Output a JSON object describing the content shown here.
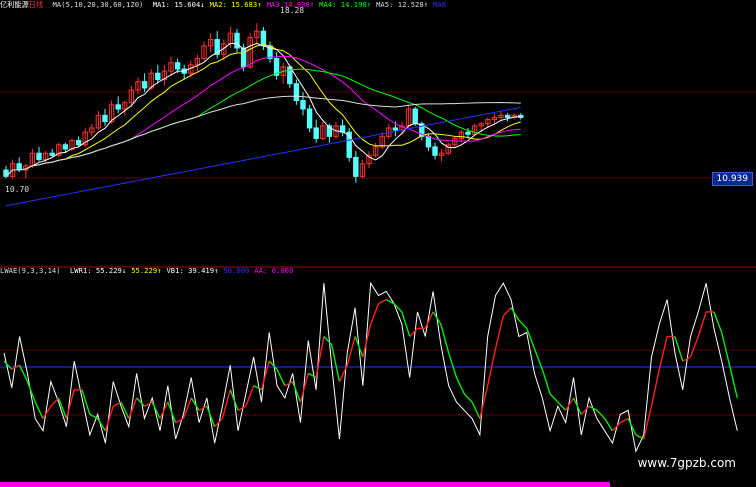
{
  "header_top": {
    "stock": "亿利能源",
    "period": "日线",
    "ma_params": "MA(5,10,20,30,60,120)",
    "items": [
      {
        "label": "MA1:",
        "value": "15.604",
        "arrow": "↓",
        "color": "#ffffff"
      },
      {
        "label": "MA2:",
        "value": "15.683",
        "arrow": "↑",
        "color": "#ffff00"
      },
      {
        "label": "MA3",
        "value": "14.938",
        "arrow": "↑",
        "color": "#ff00ff"
      },
      {
        "label": "MA4:",
        "value": "14.198",
        "arrow": "↑",
        "color": "#00ff00"
      },
      {
        "label": "MA5:",
        "value": "12.528",
        "arrow": "↑",
        "color": "#dcdcdc"
      },
      {
        "label": "MA6",
        "value": "",
        "arrow": "",
        "color": "#2233ff"
      }
    ]
  },
  "header_bottom": {
    "indicator": "LWAE(9,3,3,14)",
    "items": [
      {
        "label": "LWR1:",
        "value": "55.229",
        "arrow": "↓",
        "color": "#ffffff"
      },
      {
        "label": "",
        "value": "55.229",
        "arrow": "↑",
        "color": "#ffff00"
      },
      {
        "label": "VB1:",
        "value": "39.419",
        "arrow": "↑",
        "color": "#ffffff"
      },
      {
        "label": "",
        "value": "90.000",
        "arrow": "",
        "color": "#2233ff"
      },
      {
        "label": "AA:",
        "value": "0.000",
        "arrow": "",
        "color": "#ff00ff"
      }
    ]
  },
  "price_labels": {
    "high": "18.28",
    "low": "10.70",
    "current": "10.939"
  },
  "watermark": "www.7gpzb.com",
  "colors": {
    "up": "#ff3030",
    "down": "#54ffff",
    "bg": "#000000",
    "axis": "#8b0000"
  },
  "chart_data": [
    {
      "type": "candlestick",
      "ylim": [
        7.5,
        19.0
      ],
      "candles": [
        [
          11.3,
          11.5,
          10.9,
          11.0
        ],
        [
          11.0,
          11.8,
          10.9,
          11.6
        ],
        [
          11.6,
          11.9,
          11.2,
          11.3
        ],
        [
          11.3,
          11.6,
          10.9,
          11.5
        ],
        [
          11.5,
          12.3,
          11.4,
          12.1
        ],
        [
          12.1,
          12.4,
          11.7,
          11.8
        ],
        [
          11.8,
          12.2,
          11.6,
          12.1
        ],
        [
          12.1,
          12.3,
          11.9,
          12.0
        ],
        [
          12.0,
          12.6,
          11.9,
          12.5
        ],
        [
          12.5,
          12.6,
          12.1,
          12.3
        ],
        [
          12.3,
          12.8,
          12.2,
          12.7
        ],
        [
          12.7,
          12.9,
          12.4,
          12.5
        ],
        [
          12.5,
          13.3,
          12.4,
          13.1
        ],
        [
          13.1,
          13.5,
          12.9,
          13.3
        ],
        [
          13.3,
          14.1,
          13.2,
          13.9
        ],
        [
          13.9,
          14.2,
          13.4,
          13.6
        ],
        [
          13.6,
          14.6,
          13.5,
          14.4
        ],
        [
          14.4,
          14.8,
          14.0,
          14.2
        ],
        [
          14.2,
          14.6,
          13.9,
          14.5
        ],
        [
          14.5,
          15.3,
          14.3,
          15.1
        ],
        [
          15.1,
          15.7,
          14.9,
          15.5
        ],
        [
          15.5,
          15.9,
          15.0,
          15.2
        ],
        [
          15.2,
          16.1,
          15.1,
          15.9
        ],
        [
          15.9,
          16.3,
          15.4,
          15.6
        ],
        [
          15.6,
          16.3,
          15.3,
          16.0
        ],
        [
          16.0,
          16.7,
          15.8,
          16.4
        ],
        [
          16.4,
          16.6,
          15.9,
          16.1
        ],
        [
          16.1,
          16.3,
          15.6,
          15.9
        ],
        [
          15.9,
          16.5,
          15.7,
          16.3
        ],
        [
          16.3,
          16.8,
          16.0,
          16.6
        ],
        [
          16.6,
          17.4,
          16.5,
          17.2
        ],
        [
          17.2,
          17.8,
          16.9,
          17.5
        ],
        [
          17.5,
          17.9,
          16.6,
          16.8
        ],
        [
          16.8,
          17.5,
          16.5,
          17.3
        ],
        [
          17.3,
          18.1,
          17.1,
          17.8
        ],
        [
          17.8,
          18.0,
          16.9,
          17.1
        ],
        [
          17.1,
          17.3,
          16.0,
          16.2
        ],
        [
          16.2,
          17.8,
          16.1,
          17.6
        ],
        [
          17.6,
          18.28,
          17.3,
          17.9
        ],
        [
          17.9,
          18.1,
          17.0,
          17.2
        ],
        [
          17.2,
          17.4,
          16.4,
          16.6
        ],
        [
          16.6,
          16.9,
          15.6,
          15.8
        ],
        [
          15.8,
          16.4,
          15.4,
          16.2
        ],
        [
          16.2,
          16.3,
          15.2,
          15.4
        ],
        [
          15.4,
          15.6,
          14.4,
          14.6
        ],
        [
          14.6,
          15.0,
          13.9,
          14.2
        ],
        [
          14.2,
          14.4,
          13.1,
          13.3
        ],
        [
          13.3,
          13.7,
          12.6,
          12.8
        ],
        [
          12.8,
          13.6,
          12.7,
          13.4
        ],
        [
          13.4,
          13.5,
          12.6,
          12.9
        ],
        [
          12.9,
          13.6,
          12.8,
          13.4
        ],
        [
          13.4,
          13.7,
          12.9,
          13.1
        ],
        [
          13.1,
          13.3,
          11.7,
          11.9
        ],
        [
          11.9,
          12.2,
          10.7,
          11.0
        ],
        [
          11.0,
          11.8,
          10.9,
          11.6
        ],
        [
          11.6,
          12.2,
          11.4,
          12.0
        ],
        [
          12.0,
          12.6,
          11.9,
          12.4
        ],
        [
          12.4,
          13.1,
          12.3,
          12.9
        ],
        [
          12.9,
          13.5,
          12.8,
          13.3
        ],
        [
          13.3,
          13.6,
          12.9,
          13.2
        ],
        [
          13.2,
          13.6,
          13.0,
          13.4
        ],
        [
          13.4,
          14.4,
          13.3,
          14.2
        ],
        [
          14.2,
          14.3,
          13.4,
          13.5
        ],
        [
          13.5,
          13.6,
          12.7,
          12.9
        ],
        [
          12.9,
          13.0,
          12.2,
          12.4
        ],
        [
          12.4,
          12.6,
          11.8,
          12.0
        ],
        [
          12.0,
          12.3,
          11.7,
          12.1
        ],
        [
          12.1,
          12.6,
          12.0,
          12.5
        ],
        [
          12.5,
          12.9,
          12.4,
          12.8
        ],
        [
          12.8,
          13.2,
          12.6,
          13.1
        ],
        [
          13.1,
          13.3,
          12.8,
          13.0
        ],
        [
          13.0,
          13.5,
          12.9,
          13.4
        ],
        [
          13.4,
          13.6,
          13.1,
          13.5
        ],
        [
          13.5,
          13.8,
          13.3,
          13.7
        ],
        [
          13.7,
          14.0,
          13.5,
          13.8
        ],
        [
          13.8,
          14.1,
          13.6,
          13.9
        ],
        [
          13.9,
          14.0,
          13.6,
          13.8
        ],
        [
          13.8,
          14.0,
          13.7,
          13.9
        ],
        [
          13.9,
          14.0,
          13.7,
          13.8
        ]
      ]
    },
    {
      "type": "line",
      "ylim": [
        0,
        100
      ],
      "series": [
        {
          "name": "LWR1",
          "values": [
            62,
            45,
            70,
            52,
            30,
            24,
            48,
            38,
            26,
            58,
            40,
            22,
            32,
            18,
            48,
            36,
            26,
            52,
            30,
            40,
            24,
            46,
            20,
            32,
            50,
            28,
            40,
            18,
            36,
            56,
            24,
            42,
            60,
            38,
            72,
            46,
            40,
            52,
            28,
            68,
            44,
            96,
            56,
            20,
            62,
            84,
            46,
            96,
            90,
            92,
            86,
            76,
            50,
            82,
            70,
            92,
            66,
            46,
            38,
            34,
            30,
            22,
            70,
            90,
            96,
            88,
            70,
            72,
            52,
            40,
            24,
            36,
            28,
            50,
            22,
            40,
            30,
            24,
            18,
            32,
            34,
            14,
            22,
            60,
            76,
            88,
            62,
            44,
            70,
            82,
            96,
            74,
            58,
            40,
            24
          ]
        },
        {
          "name": "LWR2",
          "values": [
            58,
            54,
            56,
            48,
            38,
            30,
            36,
            40,
            30,
            44,
            44,
            32,
            30,
            24,
            36,
            38,
            30,
            40,
            36,
            38,
            30,
            38,
            28,
            30,
            40,
            34,
            36,
            26,
            30,
            44,
            34,
            36,
            46,
            44,
            58,
            54,
            46,
            48,
            38,
            52,
            50,
            70,
            66,
            48,
            56,
            70,
            60,
            76,
            86,
            88,
            86,
            82,
            70,
            74,
            74,
            82,
            76,
            62,
            50,
            42,
            38,
            30,
            46,
            64,
            80,
            84,
            78,
            74,
            64,
            54,
            42,
            38,
            34,
            40,
            32,
            36,
            34,
            30,
            24,
            28,
            30,
            22,
            20,
            36,
            54,
            70,
            70,
            58,
            60,
            70,
            82,
            82,
            72,
            56,
            40
          ]
        }
      ]
    }
  ]
}
